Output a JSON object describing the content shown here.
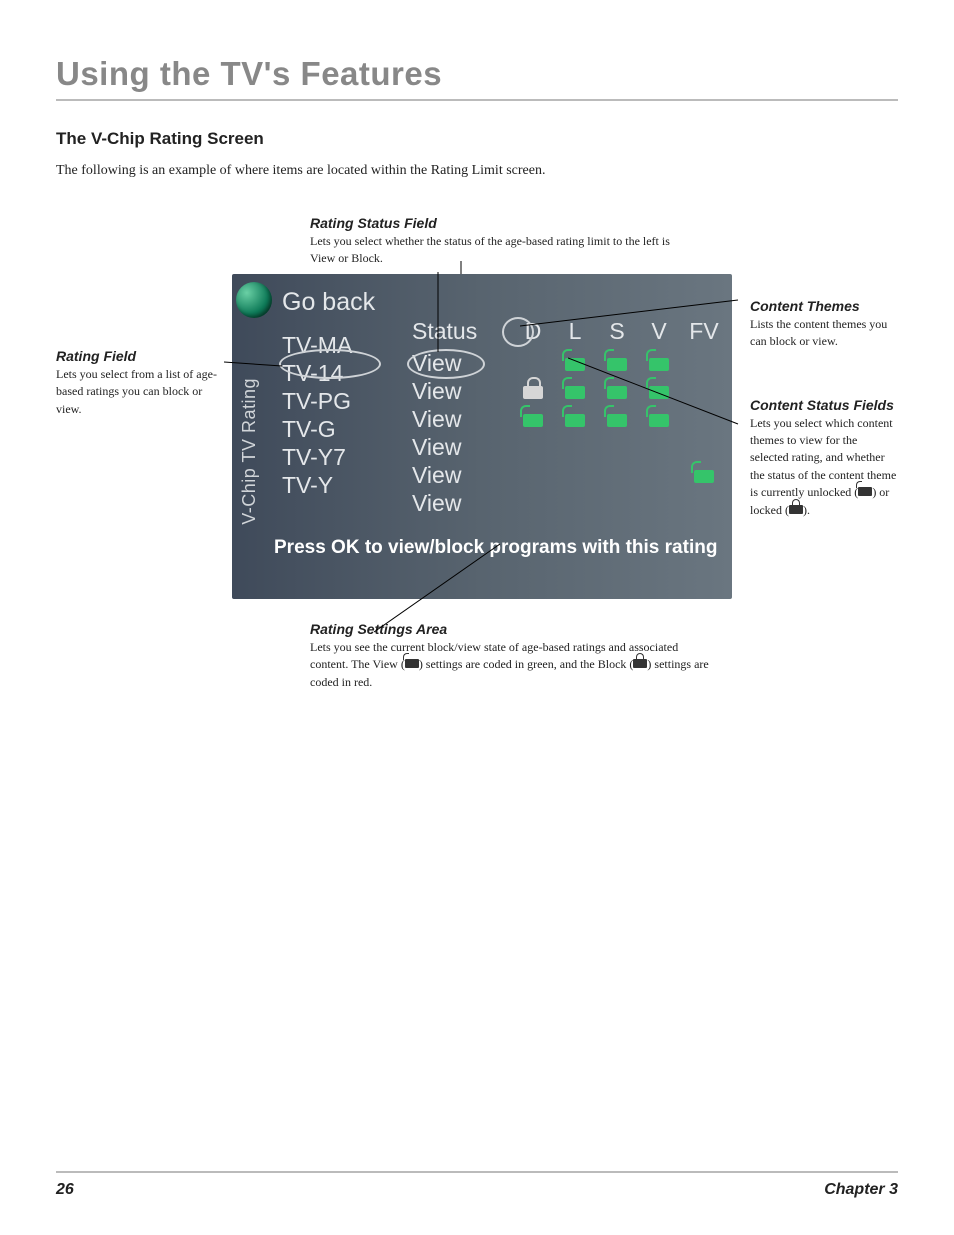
{
  "chapter_title": "Using the TV's Features",
  "section_title": "The V-Chip Rating Screen",
  "intro": "The following is an example of where items are located within the Rating Limit screen.",
  "callouts": {
    "rating_field": {
      "title": "Rating Field",
      "body": "Lets you select from a list of age-based ratings you can block or view."
    },
    "rating_status": {
      "title": "Rating Status Field",
      "body": "Lets you select whether the status of the age-based rating limit to the left is View or Block."
    },
    "content_themes": {
      "title": "Content Themes",
      "body": "Lists the content themes you can block or view."
    },
    "content_status": {
      "title": "Content Status Fields",
      "body_pre": "Lets you select which content themes to view for the selected rating, and whether the status of the content theme is currently unlocked (",
      "body_mid": ") or locked (",
      "body_post": ")."
    },
    "rating_settings": {
      "title": "Rating Settings Area",
      "body_pre": "Lets you see the current block/view state of age-based ratings and associated content. The View (",
      "body_mid": ") settings are coded in green, and the Block (",
      "body_post": ") settings are coded in red."
    }
  },
  "screen": {
    "sidebar_label": "V-Chip TV Rating",
    "go_back": "Go back",
    "status_header": "Status",
    "theme_headers": [
      "D",
      "L",
      "S",
      "V",
      "FV"
    ],
    "rows": [
      {
        "rating": "TV-MA",
        "status": "View",
        "cells": [
          "",
          "open",
          "open",
          "open",
          ""
        ]
      },
      {
        "rating": "TV-14",
        "status": "View",
        "cells": [
          "closed",
          "open",
          "open",
          "open",
          ""
        ]
      },
      {
        "rating": "TV-PG",
        "status": "View",
        "cells": [
          "open",
          "open",
          "open",
          "open",
          ""
        ]
      },
      {
        "rating": "TV-G",
        "status": "View",
        "cells": [
          "",
          "",
          "",
          "",
          ""
        ]
      },
      {
        "rating": "TV-Y7",
        "status": "View",
        "cells": [
          "",
          "",
          "",
          "",
          "open"
        ]
      },
      {
        "rating": "TV-Y",
        "status": "View",
        "cells": [
          "",
          "",
          "",
          "",
          ""
        ]
      }
    ],
    "status_bar": "Press OK to view/block programs with this rating"
  },
  "footer": {
    "page": "26",
    "chapter": "Chapter 3"
  }
}
